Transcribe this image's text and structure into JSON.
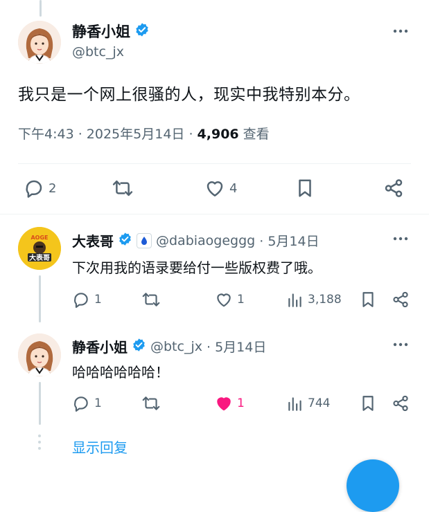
{
  "main_tweet": {
    "display_name": "静香小姐",
    "handle": "@btc_jx",
    "text": "我只是一个网上很骚的人，现实中我特别本分。",
    "time": "下午4:43 · 2025年5月14日 · ",
    "views_count": "4,906",
    "views_label": " 查看",
    "reply_count": "2",
    "like_count": "4"
  },
  "replies": [
    {
      "display_name": "大表哥",
      "handle": "@dabiaogeggg",
      "date": "· 5月14日",
      "text": "下次用我的语录要给付一些版权费了哦。",
      "reply_count": "1",
      "like_count": "1",
      "view_count": "3,188"
    },
    {
      "display_name": "静香小姐",
      "handle": "@btc_jx",
      "date": "· 5月14日",
      "text": "哈哈哈哈哈哈！",
      "reply_count": "1",
      "like_count": "1",
      "view_count": "744"
    }
  ],
  "show_replies_label": "显示回复",
  "colors": {
    "accent": "#1d9bf0",
    "like_active": "#f91880",
    "muted": "#536471"
  }
}
